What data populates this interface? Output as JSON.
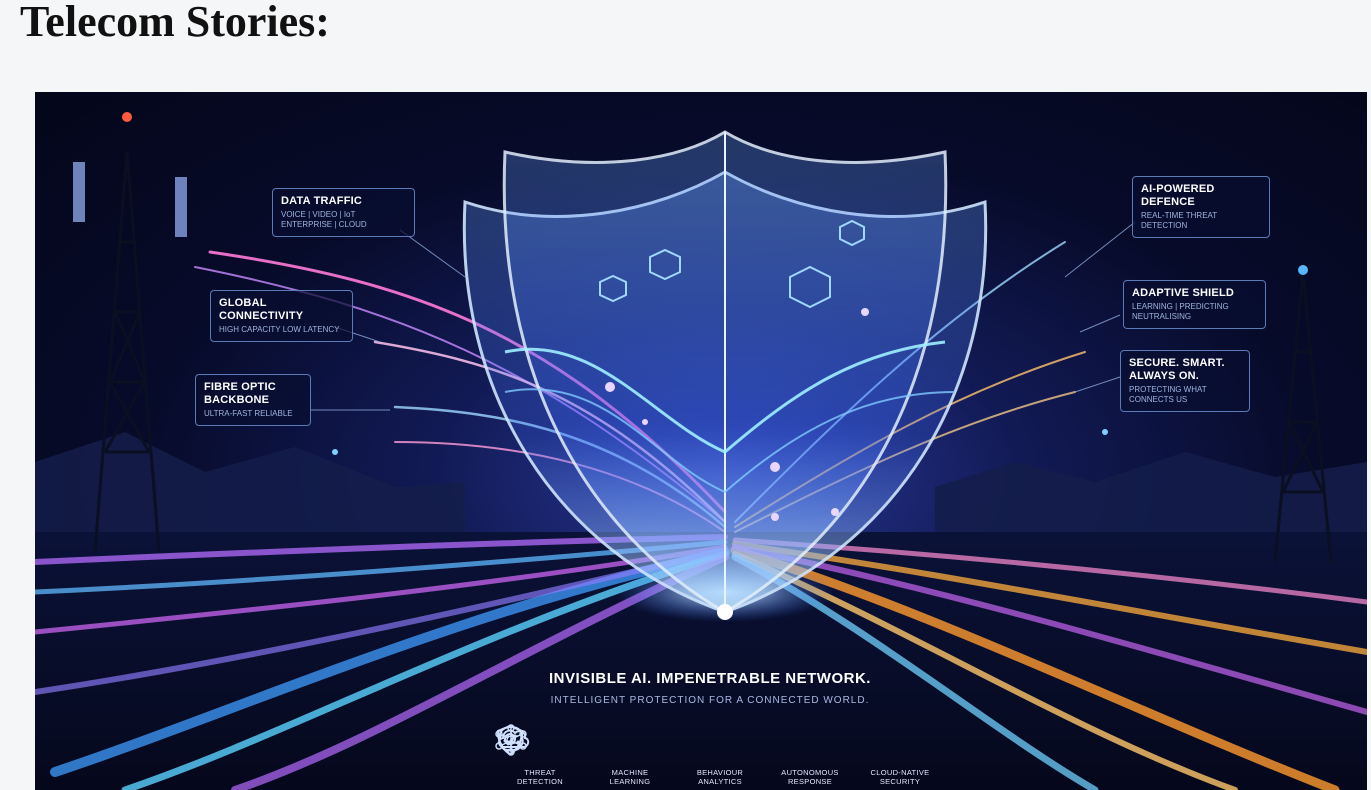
{
  "page": {
    "title": "Telecom Stories:"
  },
  "hero": {
    "callouts": {
      "data_traffic": {
        "heading": "DATA TRAFFIC",
        "sub": "VOICE | VIDEO | IoT ENTERPRISE | CLOUD"
      },
      "global_connectivity": {
        "heading": "GLOBAL CONNECTIVITY",
        "sub": "HIGH CAPACITY LOW LATENCY"
      },
      "fibre_optic": {
        "heading": "FIBRE OPTIC BACKBONE",
        "sub": "ULTRA-FAST RELIABLE"
      },
      "ai_defence": {
        "heading": "AI-POWERED DEFENCE",
        "sub": "REAL-TIME THREAT DETECTION"
      },
      "adaptive_shield": {
        "heading": "ADAPTIVE SHIELD",
        "sub": "LEARNING | PREDICTING NEUTRALISING"
      },
      "secure_smart": {
        "heading": "SECURE. SMART. ALWAYS ON.",
        "sub": "PROTECTING WHAT CONNECTS US"
      }
    },
    "tagline": "INVISIBLE AI. IMPENETRABLE NETWORK.",
    "subtagline": "INTELLIGENT PROTECTION FOR A CONNECTED WORLD.",
    "features": [
      {
        "label": "THREAT DETECTION",
        "icon": "shield-scan-icon"
      },
      {
        "label": "MACHINE LEARNING",
        "icon": "brain-icon"
      },
      {
        "label": "BEHAVIOUR ANALYTICS",
        "icon": "network-nodes-icon"
      },
      {
        "label": "AUTONOMOUS RESPONSE",
        "icon": "shield-check-icon"
      },
      {
        "label": "CLOUD-NATIVE SECURITY",
        "icon": "cloud-icon"
      }
    ],
    "colors": {
      "accent_blue": "#3fb6ff",
      "accent_purple": "#b06bff",
      "accent_orange": "#ffae3c",
      "night": "#070b2a"
    }
  }
}
